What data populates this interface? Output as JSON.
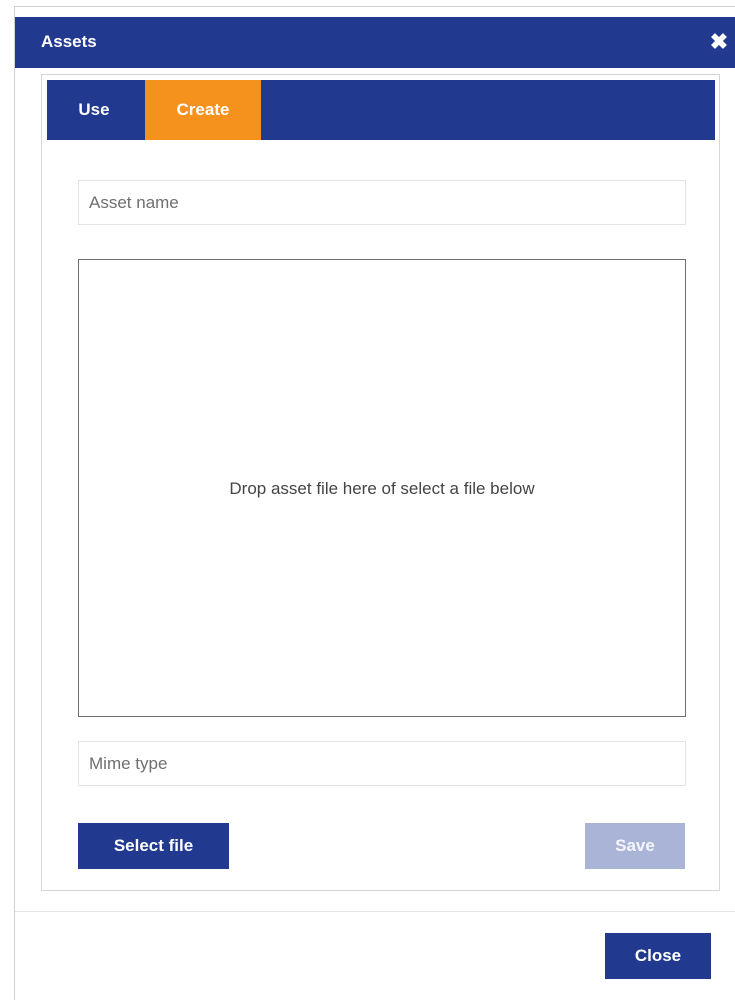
{
  "dialog": {
    "title": "Assets",
    "close_icon_glyph": "✖",
    "close_button_label": "Close"
  },
  "tabs": [
    {
      "label": "Use",
      "active": false
    },
    {
      "label": "Create",
      "active": true
    }
  ],
  "create_form": {
    "asset_name_placeholder": "Asset name",
    "asset_name_value": "",
    "dropzone_text": "Drop asset file here of select a file below",
    "mime_type_placeholder": "Mime type",
    "mime_type_value": "",
    "select_file_label": "Select file",
    "save_label": "Save",
    "save_enabled": false
  },
  "colors": {
    "primary": "#213a8f",
    "accent": "#f5921e",
    "disabled": "#aab4d6"
  }
}
